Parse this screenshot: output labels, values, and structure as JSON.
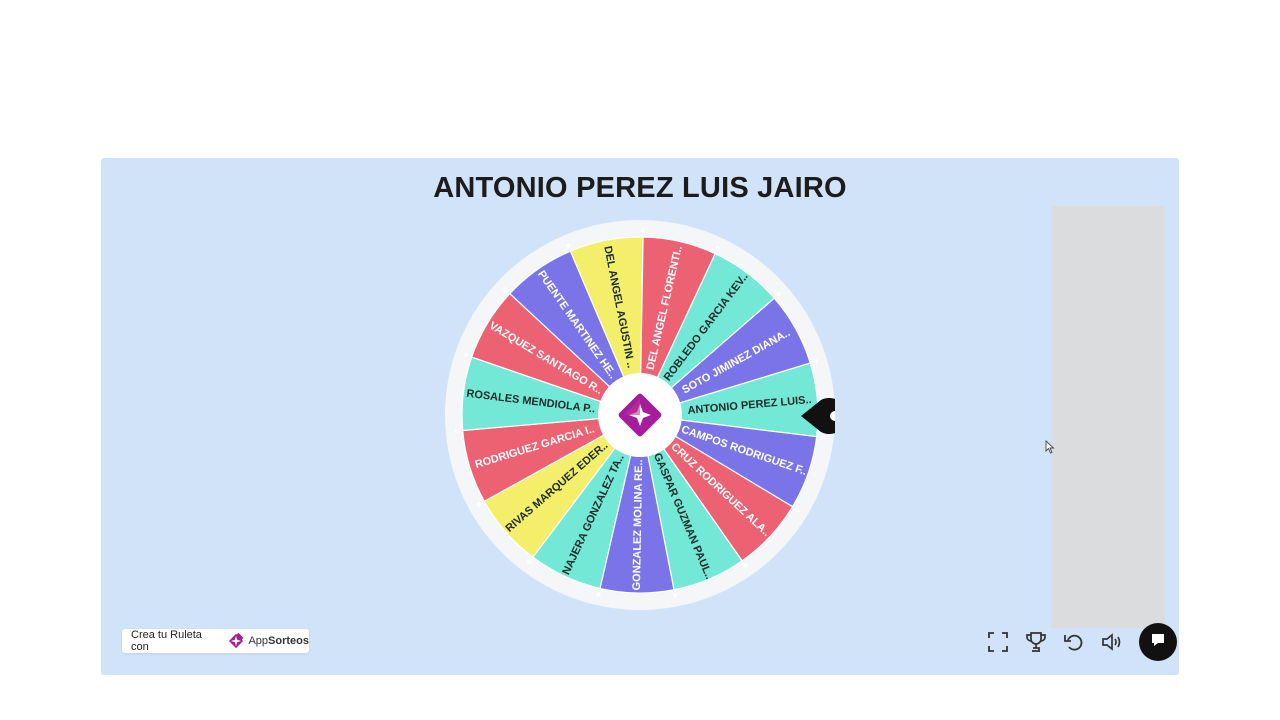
{
  "winner_title": "ANTONIO PEREZ LUIS JAIRO",
  "wheel": {
    "segments": [
      {
        "label": "ANTONIO PEREZ LUIS..",
        "color": "#74e8d6"
      },
      {
        "label": "CAMPOS RODRIGUEZ F..",
        "color": "#7b74e8"
      },
      {
        "label": "CRUZ RODRIGUEZ ALA..",
        "color": "#ec6272"
      },
      {
        "label": "GASPAR GUZMAN PAUL..",
        "color": "#74e8d6"
      },
      {
        "label": "GONZALEZ MOLINA RE..",
        "color": "#7b74e8"
      },
      {
        "label": "NAJERA GONZALEZ TA..",
        "color": "#74e8d6"
      },
      {
        "label": "RIVAS MARQUEZ EDER..",
        "color": "#f3ef6a"
      },
      {
        "label": "RODRIGUEZ GARCIA I..",
        "color": "#ec6272"
      },
      {
        "label": "ROSALES MENDIOLA P..",
        "color": "#74e8d6"
      },
      {
        "label": "VAZQUEZ SANTIAGO R..",
        "color": "#ec6272"
      },
      {
        "label": "PUENTE MARTINEZ HE..",
        "color": "#7b74e8"
      },
      {
        "label": "DEL ANGEL AGUSTIN ..",
        "color": "#f3ef6a"
      },
      {
        "label": "DEL ANGEL FLORENTI..",
        "color": "#ec6272"
      },
      {
        "label": "ROBLEDO GARCIA KEV..",
        "color": "#74e8d6"
      },
      {
        "label": "SOTO JIMINEZ DIANA..",
        "color": "#7b74e8"
      }
    ],
    "center_color": "#a51d9a"
  },
  "branding": {
    "prefix": "Crea tu Ruleta con",
    "app": "App",
    "name": "Sorteos"
  },
  "controls": {
    "fullscreen_icon": "fullscreen-icon",
    "trophy_icon": "trophy-icon",
    "reset_icon": "undo-icon",
    "sound_icon": "volume-icon",
    "chat_icon": "chat-icon"
  }
}
